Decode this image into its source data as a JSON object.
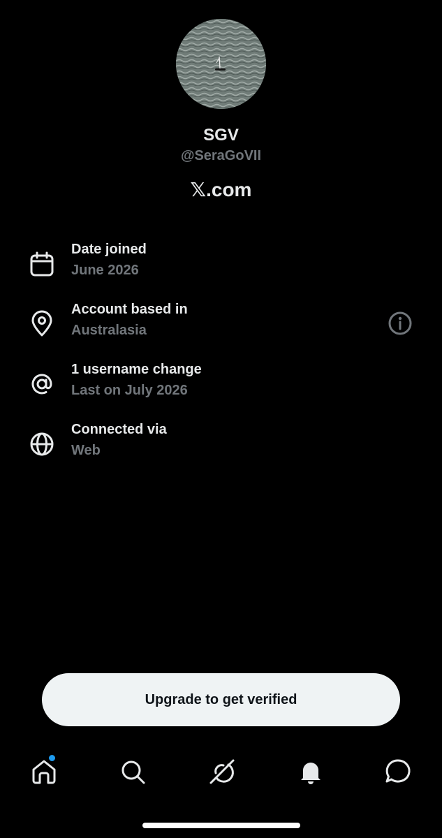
{
  "profile": {
    "name": "SGV",
    "handle": "@SeraGoVII",
    "site_mark": "𝕏",
    "site_suffix": ".com",
    "avatar_icon": "profile-photo"
  },
  "info_rows": [
    {
      "title": "Date joined",
      "value": "June 2026",
      "icon": "calendar-icon"
    },
    {
      "title": "Account based in",
      "value": "Australasia",
      "icon": "location-pin-icon"
    },
    {
      "title": "1 username change",
      "value": "Last on July 2026",
      "icon": "at-sign-icon"
    },
    {
      "title": "Connected via",
      "value": "Web",
      "icon": "globe-icon"
    }
  ],
  "upgrade_button": {
    "label": "Upgrade to get verified"
  },
  "tabs": [
    {
      "name": "home",
      "icon": "home-icon",
      "has_notification_dot": true
    },
    {
      "name": "search",
      "icon": "search-icon"
    },
    {
      "name": "grok",
      "icon": "grok-icon"
    },
    {
      "name": "notifications",
      "icon": "bell-icon"
    },
    {
      "name": "messages",
      "icon": "chat-bubble-icon"
    }
  ],
  "colors": {
    "background": "#000000",
    "primary_text": "#e7e9ea",
    "secondary_text": "#71767b",
    "button_bg": "#eff3f4",
    "accent": "#1d9bf0"
  }
}
